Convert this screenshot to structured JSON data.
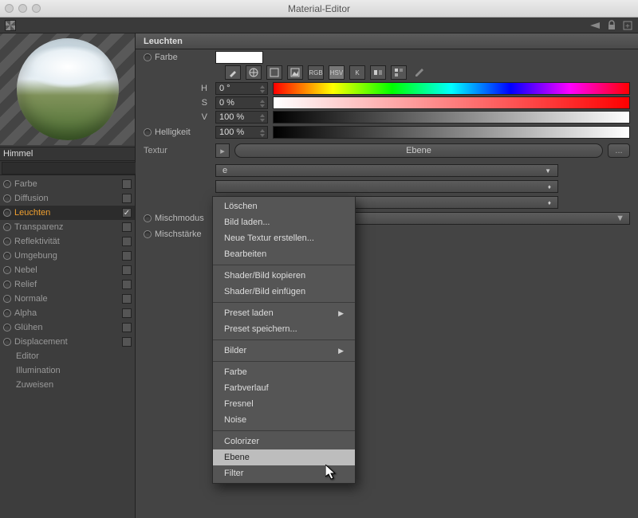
{
  "window": {
    "title": "Material-Editor"
  },
  "material": {
    "name": "Himmel"
  },
  "channels": [
    {
      "label": "Farbe",
      "checked": false
    },
    {
      "label": "Diffusion",
      "checked": false
    },
    {
      "label": "Leuchten",
      "checked": true,
      "selected": true
    },
    {
      "label": "Transparenz",
      "checked": false
    },
    {
      "label": "Reflektivität",
      "checked": false
    },
    {
      "label": "Umgebung",
      "checked": false
    },
    {
      "label": "Nebel",
      "checked": false
    },
    {
      "label": "Relief",
      "checked": false
    },
    {
      "label": "Normale",
      "checked": false
    },
    {
      "label": "Alpha",
      "checked": false
    },
    {
      "label": "Glühen",
      "checked": false
    },
    {
      "label": "Displacement",
      "checked": false
    }
  ],
  "sub_channels": [
    {
      "label": "Editor"
    },
    {
      "label": "Illumination"
    },
    {
      "label": "Zuweisen"
    }
  ],
  "panel": {
    "title": "Leuchten",
    "color_label": "Farbe",
    "color_swatch": "#ffffff",
    "tool_labels": {
      "rgb": "RGB",
      "hsv": "HSV",
      "k": "K"
    },
    "hsv": {
      "h_label": "H",
      "h_value": "0 °",
      "s_label": "S",
      "s_value": "0 %",
      "v_label": "V",
      "v_value": "100 %"
    },
    "brightness_label": "Helligkeit",
    "brightness_value": "100 %",
    "textur_label": "Textur",
    "textur_button": "Ebene",
    "textur_extra": "...",
    "mix_label": "Mischmodus",
    "strength_label": "Mischstärke"
  },
  "context_menu": [
    {
      "label": "Löschen"
    },
    {
      "label": "Bild laden..."
    },
    {
      "label": "Neue Textur erstellen..."
    },
    {
      "label": "Bearbeiten"
    },
    {
      "sep": true
    },
    {
      "label": "Shader/Bild kopieren"
    },
    {
      "label": "Shader/Bild einfügen"
    },
    {
      "sep": true
    },
    {
      "label": "Preset laden",
      "submenu": true
    },
    {
      "label": "Preset speichern..."
    },
    {
      "sep": true
    },
    {
      "label": "Bilder",
      "submenu": true
    },
    {
      "sep": true
    },
    {
      "label": "Farbe"
    },
    {
      "label": "Farbverlauf"
    },
    {
      "label": "Fresnel"
    },
    {
      "label": "Noise"
    },
    {
      "sep": true
    },
    {
      "label": "Colorizer"
    },
    {
      "label": "Ebene",
      "selected": true
    },
    {
      "label": "Filter"
    }
  ],
  "hidden_field": {
    "value": "e"
  }
}
